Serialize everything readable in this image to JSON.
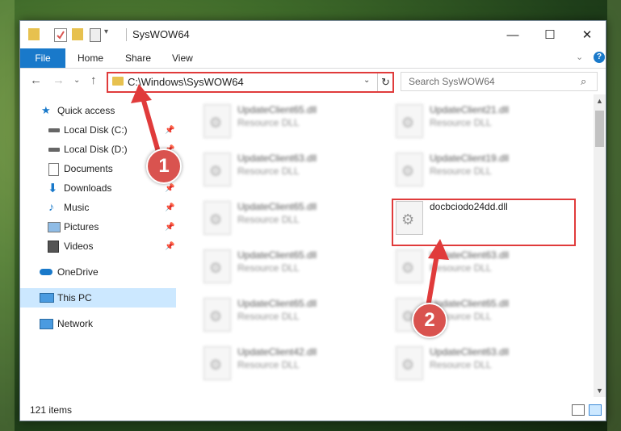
{
  "window": {
    "title": "SysWOW64",
    "controls": {
      "minimize": "—",
      "maximize": "☐",
      "close": "✕"
    }
  },
  "ribbon": {
    "tabs": [
      "File",
      "Home",
      "Share",
      "View"
    ],
    "chevron": "⌄",
    "help": "?"
  },
  "navigation": {
    "back": "←",
    "forward": "→",
    "recent": "⌄",
    "up": "↑",
    "address": "C:\\Windows\\SysWOW64",
    "address_dropdown": "⌄",
    "refresh": "↻",
    "search_placeholder": "Search SysWOW64",
    "search_icon": "⌕"
  },
  "sidebar": {
    "items": [
      {
        "label": "Quick access",
        "icon": "star-icon",
        "pinned": false
      },
      {
        "label": "Local Disk (C:)",
        "icon": "drive-icon",
        "pinned": true
      },
      {
        "label": "Local Disk (D:)",
        "icon": "drive-icon",
        "pinned": true
      },
      {
        "label": "Documents",
        "icon": "documents-icon",
        "pinned": true
      },
      {
        "label": "Downloads",
        "icon": "download-icon",
        "pinned": true
      },
      {
        "label": "Music",
        "icon": "music-icon",
        "pinned": true
      },
      {
        "label": "Pictures",
        "icon": "pictures-icon",
        "pinned": true
      },
      {
        "label": "Videos",
        "icon": "videos-icon",
        "pinned": true
      },
      {
        "label": "OneDrive",
        "icon": "cloud-icon",
        "pinned": false
      },
      {
        "label": "This PC",
        "icon": "computer-icon",
        "pinned": false,
        "selected": true
      },
      {
        "label": "Network",
        "icon": "network-icon",
        "pinned": false
      }
    ],
    "pin_glyph": "📌"
  },
  "files": [
    {
      "name": "UpdateClient65.dll",
      "type": "Resource DLL",
      "blurred": true
    },
    {
      "name": "UpdateClient21.dll",
      "type": "Resource DLL",
      "blurred": true
    },
    {
      "name": "UpdateClient63.dll",
      "type": "Resource DLL",
      "blurred": true
    },
    {
      "name": "UpdateClient19.dll",
      "type": "Resource DLL",
      "blurred": true
    },
    {
      "name": "UpdateClient65.dll",
      "type": "Resource DLL",
      "blurred": true
    },
    {
      "name": "docbciodo24dd.dll",
      "type": "",
      "blurred": false
    },
    {
      "name": "UpdateClient65.dll",
      "type": "Resource DLL",
      "blurred": true
    },
    {
      "name": "UpdateClient63.dll",
      "type": "Resource DLL",
      "blurred": true
    },
    {
      "name": "UpdateClient65.dll",
      "type": "Resource DLL",
      "blurred": true
    },
    {
      "name": "UpdateClient65.dll",
      "type": "Resource DLL",
      "blurred": true
    },
    {
      "name": "UpdateClient42.dll",
      "type": "Resource DLL",
      "blurred": true
    },
    {
      "name": "UpdateClient63.dll",
      "type": "Resource DLL",
      "blurred": true
    }
  ],
  "status": {
    "items_count": "121 items"
  },
  "annotations": {
    "step1": "1",
    "step2": "2",
    "color": "#e03b3b"
  }
}
